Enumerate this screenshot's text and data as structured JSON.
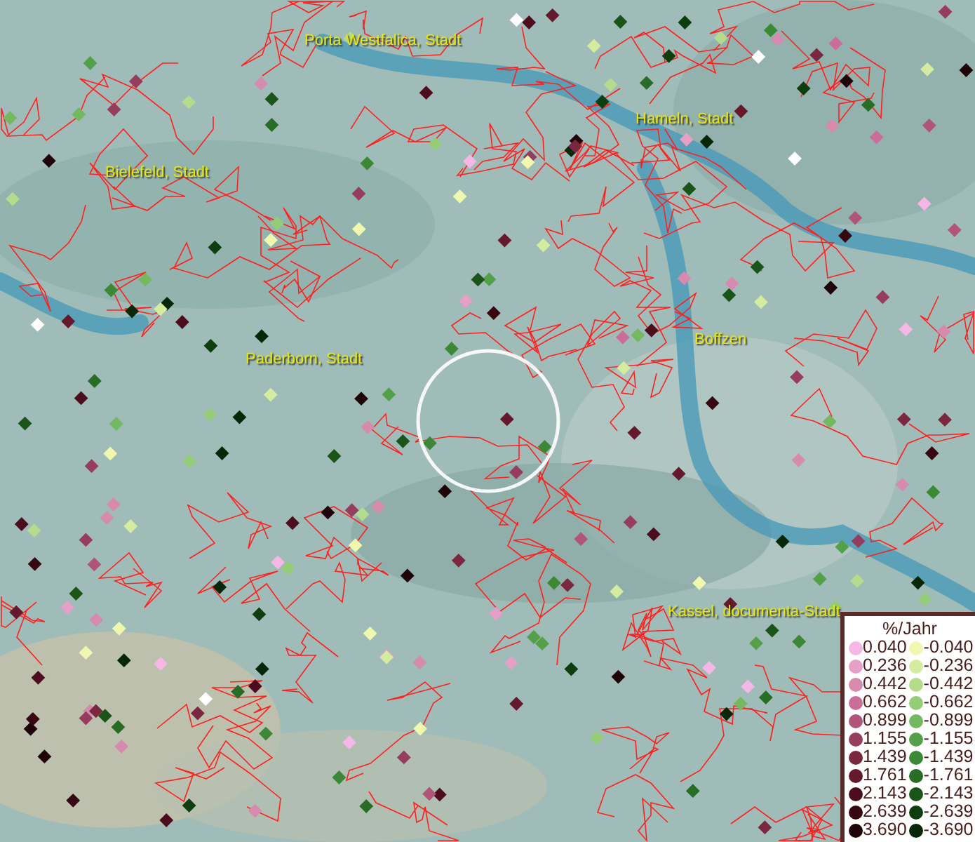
{
  "map": {
    "places": [
      {
        "label": "Porta Westfalica, Stadt"
      },
      {
        "label": "Hameln, Stadt"
      },
      {
        "label": "Bielefeld, Stadt"
      },
      {
        "label": "Paderborn, Stadt"
      },
      {
        "label": "Boffzen"
      },
      {
        "label": "Kassel, documenta-Stadt"
      }
    ],
    "legend": {
      "title": "%/Jahr",
      "positive": [
        {
          "label": "0.040",
          "color": "#f5b8e6"
        },
        {
          "label": "0.236",
          "color": "#e6a0c8"
        },
        {
          "label": "0.442",
          "color": "#d58aae"
        },
        {
          "label": "0.662",
          "color": "#c86e98"
        },
        {
          "label": "0.899",
          "color": "#b05478"
        },
        {
          "label": "1.155",
          "color": "#963c5c"
        },
        {
          "label": "1.439",
          "color": "#7a2840"
        },
        {
          "label": "1.761",
          "color": "#641a2c"
        },
        {
          "label": "2.143",
          "color": "#4c0e1c"
        },
        {
          "label": "2.639",
          "color": "#380812"
        },
        {
          "label": "3.690",
          "color": "#1e0408"
        }
      ],
      "negative": [
        {
          "label": "-0.040",
          "color": "#f0f8b0"
        },
        {
          "label": "-0.236",
          "color": "#d4eca0"
        },
        {
          "label": "-0.442",
          "color": "#b4dc8c"
        },
        {
          "label": "-0.662",
          "color": "#94cc78"
        },
        {
          "label": "-0.899",
          "color": "#74b860"
        },
        {
          "label": "-1.155",
          "color": "#54a048"
        },
        {
          "label": "-1.439",
          "color": "#3c8836"
        },
        {
          "label": "-1.761",
          "color": "#286c26"
        },
        {
          "label": "-2.143",
          "color": "#1a5418"
        },
        {
          "label": "-2.639",
          "color": "#0e3e10"
        },
        {
          "label": "-3.690",
          "color": "#062808"
        }
      ]
    }
  }
}
